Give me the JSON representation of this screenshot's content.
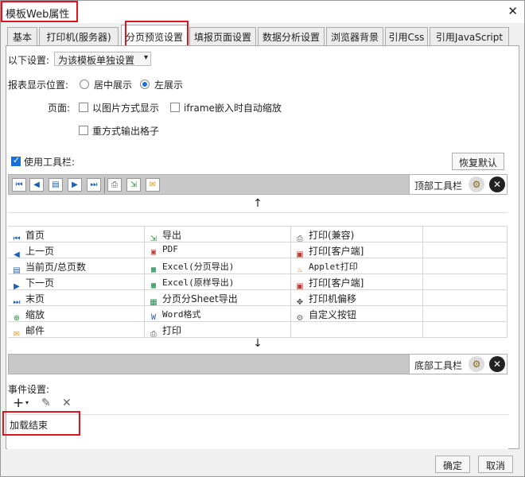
{
  "window": {
    "title": "模板Web属性",
    "close_glyph": "✕"
  },
  "tabs": [
    "基本",
    "打印机(服务器)",
    "分页预览设置",
    "填报页面设置",
    "数据分析设置",
    "浏览器背景",
    "引用Css",
    "引用JavaScript"
  ],
  "settings": {
    "scope_label": "以下设置:",
    "scope_value": "为该模板单独设置",
    "position_label": "报表显示位置:",
    "position_options": [
      "居中展示",
      "左展示"
    ],
    "position_selected": "左展示",
    "page_label": "页面:",
    "page_options": [
      "以图片方式显示",
      "iframe嵌入时自动缩放",
      "重方式输出格子"
    ],
    "use_toolbar_label": "使用工具栏:",
    "use_toolbar_checked": true,
    "restore_default": "恢复默认"
  },
  "top_toolbar": {
    "label": "顶部工具栏",
    "arrow": "↑"
  },
  "bottom_toolbar": {
    "label": "底部工具栏",
    "arrow": "↓"
  },
  "grid": {
    "col1": [
      "首页",
      "上一页",
      "当前页/总页数",
      "下一页",
      "末页",
      "缩放",
      "邮件"
    ],
    "col2": [
      "导出",
      "PDF",
      "Excel(分页导出)",
      "Excel(原样导出)",
      "分页分Sheet导出",
      "Word格式",
      "打印"
    ],
    "col3": [
      "打印(兼容)",
      "打印[客户端]",
      "Applet打印",
      "打印[客户端]",
      "打印机偏移",
      "自定义按钮"
    ]
  },
  "events": {
    "label": "事件设置:",
    "item": "加载结束"
  },
  "footer": {
    "ok": "确定",
    "cancel": "取消"
  },
  "colors": {
    "highlight": "#e0141e",
    "accent": "#1a6fd6"
  }
}
